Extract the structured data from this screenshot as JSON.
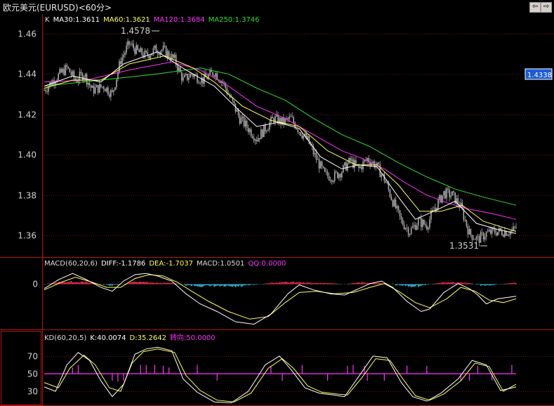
{
  "window": {
    "title": "欧元美元(EURUSD)<60分>",
    "nav_back": "⇦",
    "nav_forward": "⇨"
  },
  "colors": {
    "background": "#000000",
    "frame": "#b01515",
    "grid": "#6a1515",
    "candle": "#aaaaaa",
    "price_tag_bg": "#1a5bd6",
    "ma30": "#ffffff",
    "ma60": "#ffff55",
    "ma120": "#ff33ff",
    "ma250": "#33dd33",
    "diff": "#ffffff",
    "dea": "#ffff55",
    "hist_pos": "#ff3355",
    "hist_neg": "#33ccee",
    "k_line": "#ffffff",
    "d_line": "#ffff55",
    "turn": "#ff33ff"
  },
  "price_panel": {
    "legend": [
      {
        "text": "K",
        "color": "#dddddd"
      },
      {
        "text": "MA30:1.3611",
        "color": "#ffffff"
      },
      {
        "text": "MA60:1.3621",
        "color": "#ffff55"
      },
      {
        "text": "MA120:1.3684",
        "color": "#ff33ff"
      },
      {
        "text": "MA250:1.3746",
        "color": "#33dd33"
      }
    ],
    "high_label": "1.4578",
    "low_label": "1.3531",
    "current_price": "1.4338",
    "y_ticks": [
      "1.46",
      "1.44",
      "1.42",
      "1.40",
      "1.38",
      "1.36"
    ]
  },
  "macd_panel": {
    "legend": [
      {
        "text": "MACD(60,20,6)",
        "color": "#dddddd"
      },
      {
        "text": "DIFF:-1.1786",
        "color": "#ffffff"
      },
      {
        "text": "DEA:-1.7037",
        "color": "#ffff55"
      },
      {
        "text": "MACD:1.0501",
        "color": "#dddddd"
      },
      {
        "text": "QQ:0.0000",
        "color": "#ff33ff"
      }
    ],
    "y_ticks": [
      "0"
    ]
  },
  "kd_panel": {
    "legend": [
      {
        "text": "KD(60,20,5)",
        "color": "#dddddd"
      },
      {
        "text": "K:40.0074",
        "color": "#ffffff"
      },
      {
        "text": "D:35.2642",
        "color": "#ffff55"
      },
      {
        "text": "转向:50.0000",
        "color": "#ff33ff"
      }
    ],
    "y_ticks": [
      "70",
      "50",
      "30"
    ]
  },
  "chart_data": [
    {
      "type": "candlestick",
      "ylim": [
        1.35,
        1.469
      ],
      "y_ticks": [
        1.46,
        1.44,
        1.42,
        1.4,
        1.38,
        1.36
      ],
      "close_path": [
        [
          0,
          1.432
        ],
        [
          8,
          1.438
        ],
        [
          16,
          1.443
        ],
        [
          22,
          1.437
        ],
        [
          28,
          1.44
        ],
        [
          34,
          1.432
        ],
        [
          42,
          1.434
        ],
        [
          48,
          1.43
        ],
        [
          54,
          1.447
        ],
        [
          60,
          1.455
        ],
        [
          66,
          1.451
        ],
        [
          72,
          1.449
        ],
        [
          78,
          1.452
        ],
        [
          84,
          1.452
        ],
        [
          92,
          1.447
        ],
        [
          98,
          1.437
        ],
        [
          104,
          1.44
        ],
        [
          112,
          1.437
        ],
        [
          120,
          1.441
        ],
        [
          126,
          1.436
        ],
        [
          132,
          1.427
        ],
        [
          138,
          1.418
        ],
        [
          144,
          1.413
        ],
        [
          150,
          1.408
        ],
        [
          156,
          1.413
        ],
        [
          162,
          1.418
        ],
        [
          168,
          1.416
        ],
        [
          174,
          1.418
        ],
        [
          180,
          1.412
        ],
        [
          186,
          1.407
        ],
        [
          192,
          1.398
        ],
        [
          198,
          1.39
        ],
        [
          204,
          1.389
        ],
        [
          210,
          1.392
        ],
        [
          216,
          1.397
        ],
        [
          222,
          1.393
        ],
        [
          228,
          1.398
        ],
        [
          234,
          1.395
        ],
        [
          240,
          1.388
        ],
        [
          246,
          1.377
        ],
        [
          252,
          1.367
        ],
        [
          258,
          1.362
        ],
        [
          264,
          1.367
        ],
        [
          270,
          1.365
        ],
        [
          276,
          1.374
        ],
        [
          282,
          1.381
        ],
        [
          288,
          1.38
        ],
        [
          294,
          1.374
        ],
        [
          300,
          1.361
        ],
        [
          306,
          1.358
        ],
        [
          312,
          1.361
        ],
        [
          318,
          1.362
        ],
        [
          324,
          1.362
        ],
        [
          330,
          1.362
        ],
        [
          333,
          1.364
        ]
      ],
      "candle_count": 334,
      "ma30": [
        [
          0,
          1.434
        ],
        [
          20,
          1.439
        ],
        [
          40,
          1.436
        ],
        [
          56,
          1.445
        ],
        [
          80,
          1.451
        ],
        [
          100,
          1.442
        ],
        [
          120,
          1.434
        ],
        [
          136,
          1.423
        ],
        [
          150,
          1.414
        ],
        [
          165,
          1.416
        ],
        [
          180,
          1.413
        ],
        [
          195,
          1.399
        ],
        [
          210,
          1.393
        ],
        [
          222,
          1.395
        ],
        [
          235,
          1.394
        ],
        [
          250,
          1.379
        ],
        [
          262,
          1.368
        ],
        [
          278,
          1.373
        ],
        [
          290,
          1.377
        ],
        [
          305,
          1.366
        ],
        [
          320,
          1.363
        ],
        [
          333,
          1.361
        ]
      ],
      "ma60": [
        [
          0,
          1.433
        ],
        [
          20,
          1.437
        ],
        [
          40,
          1.437
        ],
        [
          60,
          1.445
        ],
        [
          85,
          1.449
        ],
        [
          105,
          1.443
        ],
        [
          120,
          1.436
        ],
        [
          140,
          1.424
        ],
        [
          160,
          1.417
        ],
        [
          180,
          1.414
        ],
        [
          200,
          1.402
        ],
        [
          220,
          1.395
        ],
        [
          235,
          1.395
        ],
        [
          250,
          1.385
        ],
        [
          265,
          1.372
        ],
        [
          280,
          1.372
        ],
        [
          295,
          1.375
        ],
        [
          310,
          1.367
        ],
        [
          333,
          1.362
        ]
      ],
      "ma120": [
        [
          0,
          1.436
        ],
        [
          30,
          1.437
        ],
        [
          60,
          1.442
        ],
        [
          90,
          1.446
        ],
        [
          110,
          1.442
        ],
        [
          130,
          1.434
        ],
        [
          150,
          1.424
        ],
        [
          170,
          1.418
        ],
        [
          190,
          1.41
        ],
        [
          210,
          1.402
        ],
        [
          225,
          1.398
        ],
        [
          240,
          1.393
        ],
        [
          255,
          1.386
        ],
        [
          270,
          1.38
        ],
        [
          285,
          1.376
        ],
        [
          300,
          1.373
        ],
        [
          315,
          1.371
        ],
        [
          333,
          1.368
        ]
      ],
      "ma250": [
        [
          0,
          1.434
        ],
        [
          40,
          1.437
        ],
        [
          80,
          1.44
        ],
        [
          110,
          1.443
        ],
        [
          130,
          1.44
        ],
        [
          150,
          1.433
        ],
        [
          170,
          1.427
        ],
        [
          190,
          1.418
        ],
        [
          210,
          1.41
        ],
        [
          230,
          1.404
        ],
        [
          250,
          1.396
        ],
        [
          270,
          1.389
        ],
        [
          290,
          1.383
        ],
        [
          310,
          1.379
        ],
        [
          333,
          1.375
        ]
      ]
    },
    {
      "type": "bar",
      "name": "MACD",
      "ylim": [
        -3.5,
        1.2
      ],
      "y_ticks": [
        0
      ],
      "diff": [
        [
          0,
          -0.4
        ],
        [
          10,
          0.3
        ],
        [
          20,
          0.8
        ],
        [
          30,
          0.3
        ],
        [
          40,
          -0.3
        ],
        [
          48,
          -0.6
        ],
        [
          56,
          0.2
        ],
        [
          64,
          0.7
        ],
        [
          72,
          0.8
        ],
        [
          80,
          0.6
        ],
        [
          90,
          0.2
        ],
        [
          100,
          -0.8
        ],
        [
          110,
          -1.6
        ],
        [
          122,
          -2.2
        ],
        [
          135,
          -3.0
        ],
        [
          148,
          -3.2
        ],
        [
          160,
          -2.4
        ],
        [
          172,
          -0.8
        ],
        [
          180,
          -0.1
        ],
        [
          190,
          -0.5
        ],
        [
          202,
          -0.8
        ],
        [
          212,
          -0.9
        ],
        [
          222,
          -0.4
        ],
        [
          230,
          0.0
        ],
        [
          238,
          0.2
        ],
        [
          246,
          -0.3
        ],
        [
          256,
          -1.4
        ],
        [
          266,
          -2.2
        ],
        [
          272,
          -2.0
        ],
        [
          282,
          -0.7
        ],
        [
          292,
          0.0
        ],
        [
          300,
          -0.4
        ],
        [
          306,
          -0.9
        ],
        [
          312,
          -1.6
        ],
        [
          320,
          -1.2
        ],
        [
          333,
          -1.0
        ]
      ],
      "dea": [
        [
          0,
          -0.5
        ],
        [
          12,
          0.1
        ],
        [
          22,
          0.5
        ],
        [
          34,
          0.1
        ],
        [
          44,
          -0.3
        ],
        [
          54,
          -0.3
        ],
        [
          64,
          0.4
        ],
        [
          74,
          0.7
        ],
        [
          84,
          0.6
        ],
        [
          94,
          0.1
        ],
        [
          104,
          -0.6
        ],
        [
          116,
          -1.4
        ],
        [
          130,
          -2.2
        ],
        [
          145,
          -2.8
        ],
        [
          158,
          -2.6
        ],
        [
          170,
          -1.5
        ],
        [
          180,
          -0.7
        ],
        [
          192,
          -0.6
        ],
        [
          205,
          -0.8
        ],
        [
          218,
          -0.7
        ],
        [
          230,
          -0.3
        ],
        [
          240,
          0.0
        ],
        [
          250,
          -0.6
        ],
        [
          262,
          -1.5
        ],
        [
          272,
          -1.9
        ],
        [
          284,
          -1.2
        ],
        [
          294,
          -0.3
        ],
        [
          304,
          -0.6
        ],
        [
          314,
          -1.3
        ],
        [
          324,
          -1.5
        ],
        [
          333,
          -1.2
        ]
      ],
      "hist": [
        [
          0,
          -0.05
        ],
        [
          10,
          0.1
        ],
        [
          20,
          0.15
        ],
        [
          30,
          0.1
        ],
        [
          40,
          -0.05
        ],
        [
          48,
          -0.15
        ],
        [
          56,
          -0.05
        ],
        [
          64,
          0.15
        ],
        [
          72,
          0.1
        ],
        [
          80,
          0.05
        ],
        [
          90,
          0.05
        ],
        [
          100,
          -0.12
        ],
        [
          110,
          -0.2
        ],
        [
          122,
          -0.2
        ],
        [
          135,
          -0.25
        ],
        [
          148,
          -0.1
        ],
        [
          160,
          0.05
        ],
        [
          172,
          0.12
        ],
        [
          180,
          0.1
        ],
        [
          190,
          0.05
        ],
        [
          202,
          0.03
        ],
        [
          212,
          -0.05
        ],
        [
          222,
          0.08
        ],
        [
          230,
          0.05
        ],
        [
          238,
          0.03
        ],
        [
          246,
          -0.08
        ],
        [
          256,
          -0.2
        ],
        [
          266,
          -0.18
        ],
        [
          272,
          -0.05
        ],
        [
          282,
          0.1
        ],
        [
          292,
          0.08
        ],
        [
          300,
          0.05
        ],
        [
          306,
          -0.1
        ],
        [
          312,
          -0.15
        ],
        [
          320,
          -0.05
        ],
        [
          333,
          0.06
        ]
      ]
    },
    {
      "type": "line",
      "name": "KD",
      "ylim": [
        15,
        85
      ],
      "y_ticks": [
        70,
        50,
        30
      ],
      "k": [
        [
          0,
          35
        ],
        [
          8,
          30
        ],
        [
          16,
          60
        ],
        [
          24,
          74
        ],
        [
          32,
          65
        ],
        [
          40,
          42
        ],
        [
          48,
          24
        ],
        [
          56,
          38
        ],
        [
          64,
          72
        ],
        [
          72,
          78
        ],
        [
          80,
          80
        ],
        [
          90,
          76
        ],
        [
          98,
          44
        ],
        [
          108,
          29
        ],
        [
          120,
          18
        ],
        [
          132,
          17
        ],
        [
          144,
          30
        ],
        [
          156,
          60
        ],
        [
          166,
          70
        ],
        [
          174,
          55
        ],
        [
          184,
          34
        ],
        [
          194,
          28
        ],
        [
          204,
          26
        ],
        [
          212,
          24
        ],
        [
          222,
          47
        ],
        [
          232,
          70
        ],
        [
          242,
          68
        ],
        [
          252,
          40
        ],
        [
          260,
          24
        ],
        [
          270,
          19
        ],
        [
          280,
          28
        ],
        [
          292,
          44
        ],
        [
          302,
          65
        ],
        [
          312,
          60
        ],
        [
          322,
          31
        ],
        [
          333,
          35
        ]
      ],
      "d": [
        [
          0,
          40
        ],
        [
          10,
          34
        ],
        [
          18,
          56
        ],
        [
          28,
          71
        ],
        [
          36,
          60
        ],
        [
          46,
          34
        ],
        [
          54,
          30
        ],
        [
          62,
          62
        ],
        [
          70,
          75
        ],
        [
          80,
          78
        ],
        [
          92,
          74
        ],
        [
          100,
          48
        ],
        [
          110,
          31
        ],
        [
          122,
          20
        ],
        [
          134,
          18
        ],
        [
          146,
          28
        ],
        [
          158,
          56
        ],
        [
          168,
          67
        ],
        [
          176,
          56
        ],
        [
          186,
          36
        ],
        [
          196,
          29
        ],
        [
          206,
          27
        ],
        [
          214,
          26
        ],
        [
          224,
          45
        ],
        [
          234,
          67
        ],
        [
          244,
          65
        ],
        [
          254,
          42
        ],
        [
          262,
          25
        ],
        [
          272,
          20
        ],
        [
          282,
          27
        ],
        [
          294,
          42
        ],
        [
          304,
          62
        ],
        [
          314,
          58
        ],
        [
          324,
          30
        ],
        [
          333,
          38
        ]
      ],
      "turn": 50,
      "turn_marks": [
        [
          20,
          57
        ],
        [
          24,
          60
        ],
        [
          48,
          42
        ],
        [
          52,
          41
        ],
        [
          56,
          42
        ],
        [
          68,
          60
        ],
        [
          72,
          60
        ],
        [
          78,
          60
        ],
        [
          84,
          59
        ],
        [
          88,
          57
        ],
        [
          108,
          60
        ],
        [
          122,
          42
        ],
        [
          160,
          59
        ],
        [
          168,
          42
        ],
        [
          182,
          60
        ],
        [
          200,
          42
        ],
        [
          214,
          59
        ],
        [
          218,
          60
        ],
        [
          226,
          59
        ],
        [
          228,
          42
        ],
        [
          240,
          42
        ],
        [
          256,
          59
        ],
        [
          270,
          59
        ],
        [
          294,
          42
        ],
        [
          300,
          42
        ],
        [
          306,
          59
        ],
        [
          316,
          42
        ],
        [
          330,
          60
        ]
      ]
    }
  ]
}
